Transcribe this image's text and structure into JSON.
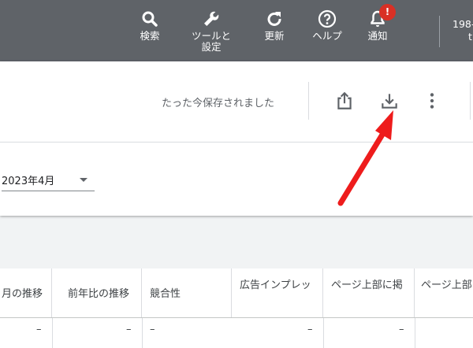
{
  "topbar": {
    "search_label": "検索",
    "tools_label_1": "ツールと",
    "tools_label_2": "設定",
    "update_label": "更新",
    "help_label": "ヘルプ",
    "notify_label": "通知",
    "notify_badge": "!",
    "account_line1": "198-",
    "account_line2": "t"
  },
  "toolbar": {
    "saved_status": "たった今保存されました"
  },
  "date_select": {
    "value": "2023年4月"
  },
  "table": {
    "headers": [
      "月の推移",
      "前年比の推移",
      "競合性",
      "広告インプレッ",
      "ページ上部に掲",
      "ページ上部"
    ],
    "first_row": [
      "–",
      "–",
      "–",
      "–",
      "–"
    ]
  },
  "colors": {
    "topbar": "#5f6368",
    "badge": "#d93025",
    "annotation_arrow": "#ee1c1c"
  },
  "icons": [
    "search-icon",
    "wrench-icon",
    "refresh-icon",
    "help-icon",
    "bell-icon",
    "share-icon",
    "download-icon",
    "more-vert-icon"
  ]
}
